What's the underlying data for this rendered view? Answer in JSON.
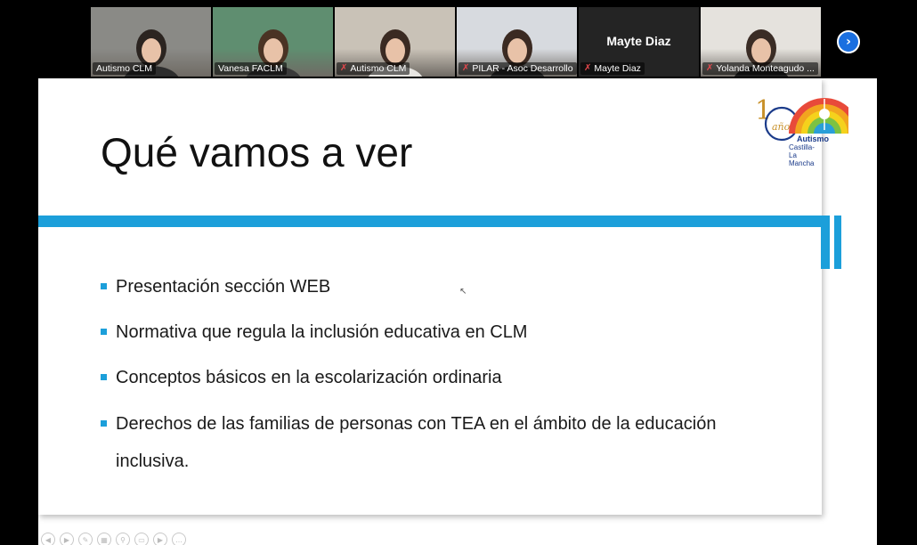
{
  "participants": [
    {
      "name": "Autismo CLM",
      "muted": false,
      "active": false,
      "camera": true,
      "bg": "#8a8a86",
      "hair": "#2b2420",
      "shirt": "#2d2d2d"
    },
    {
      "name": "Vanesa FACLM",
      "muted": false,
      "active": true,
      "camera": true,
      "bg": "#5f8e70",
      "hair": "#4a3324",
      "shirt": "#3a3a3a"
    },
    {
      "name": "Autismo CLM",
      "muted": true,
      "active": false,
      "camera": true,
      "bg": "#c9c2b7",
      "hair": "#3a2a22",
      "shirt": "#e8e6e2"
    },
    {
      "name": "PILAR - Asoc Desarrollo",
      "muted": true,
      "active": false,
      "camera": true,
      "bg": "#d7dadf",
      "hair": "#3b2a22",
      "shirt": "#2b2b2b"
    },
    {
      "name": "Mayte Diaz",
      "muted": true,
      "active": false,
      "camera": false,
      "display_name": "Mayte Diaz"
    },
    {
      "name": "Yolanda Monteagudo ...",
      "muted": true,
      "active": false,
      "camera": true,
      "bg": "#e5e2dd",
      "hair": "#3a2c25",
      "shirt": "#1f1f1f"
    }
  ],
  "strip_next_icon": "chevron-right-icon",
  "slide": {
    "title": "Qué vamos a ver",
    "logo": {
      "number": "15",
      "sub": "años",
      "line1": "Autismo",
      "line2": "Castilla-La Mancha"
    },
    "bullets": [
      "Presentación sección WEB",
      "Normativa que regula la inclusión educativa en CLM",
      "Conceptos básicos en la escolarización ordinaria",
      "Derechos de las familias de personas con TEA en el ámbito de la educación inclusiva."
    ],
    "accent_color": "#1c9fda"
  },
  "toolbar_icons": [
    "prev-icon",
    "next-icon",
    "pen-icon",
    "slides-icon",
    "zoom-icon",
    "subtitles-icon",
    "video-icon",
    "more-icon"
  ]
}
